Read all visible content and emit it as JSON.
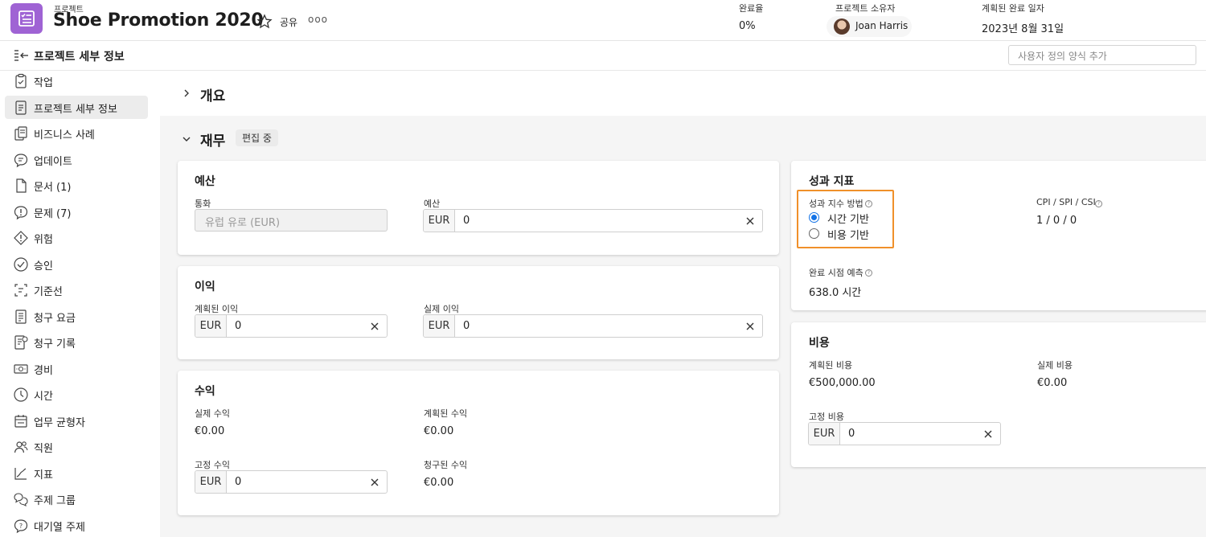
{
  "header": {
    "kicker": "프로젝트",
    "title": "Shoe Promotion 2020",
    "share_label": "공유",
    "more_label": "ooo",
    "completion_label": "완료율",
    "completion_value": "0%",
    "owner_label": "프로젝트 소유자",
    "owner_name": "Joan Harris",
    "planned_date_label": "계획된 완료 일자",
    "planned_date_value": "2023년 8월 31일"
  },
  "subheader": {
    "title": "프로젝트 세부 정보",
    "custom_form_placeholder": "사용자 정의 양식 추가"
  },
  "sidebar": {
    "items": [
      {
        "label": "작업",
        "icon": "task-clipboard-icon"
      },
      {
        "label": "프로젝트 세부 정보",
        "icon": "document-icon",
        "active": true
      },
      {
        "label": "비즈니스 사례",
        "icon": "business-case-icon"
      },
      {
        "label": "업데이트",
        "icon": "chat-bubble-icon"
      },
      {
        "label": "문서 (1)",
        "icon": "file-icon"
      },
      {
        "label": "문제 (7)",
        "icon": "issue-bubble-icon"
      },
      {
        "label": "위험",
        "icon": "risk-diamond-icon"
      },
      {
        "label": "승인",
        "icon": "approval-check-icon"
      },
      {
        "label": "기준선",
        "icon": "baseline-icon"
      },
      {
        "label": "청구 요금",
        "icon": "billing-rates-icon"
      },
      {
        "label": "청구 기록",
        "icon": "billing-records-icon"
      },
      {
        "label": "경비",
        "icon": "expense-money-icon"
      },
      {
        "label": "시간",
        "icon": "clock-icon"
      },
      {
        "label": "업무 균형자",
        "icon": "workload-calendar-icon"
      },
      {
        "label": "직원",
        "icon": "people-icon"
      },
      {
        "label": "지표",
        "icon": "metrics-line-icon"
      },
      {
        "label": "주제 그룹",
        "icon": "topic-group-icon"
      },
      {
        "label": "대기열 주제",
        "icon": "queue-topic-icon"
      }
    ]
  },
  "main": {
    "overview_title": "개요",
    "finance_title": "재무",
    "editing_badge": "편집 중",
    "budget": {
      "title": "예산",
      "currency_label": "통화",
      "currency_value": "유럽 유로 (EUR)",
      "budget_label": "예산",
      "budget_currency": "EUR",
      "budget_amount": "0"
    },
    "profit": {
      "title": "이익",
      "planned_label": "계획된 이익",
      "planned_currency": "EUR",
      "planned_amount": "0",
      "actual_label": "실제 이익",
      "actual_currency": "EUR",
      "actual_amount": "0"
    },
    "revenue": {
      "title": "수익",
      "actual_label": "실제 수익",
      "actual_value": "€0.00",
      "planned_label": "계획된 수익",
      "planned_value": "€0.00",
      "fixed_label": "고정 수익",
      "fixed_currency": "EUR",
      "fixed_amount": "0",
      "billed_label": "청구된 수익",
      "billed_value": "€0.00"
    },
    "performance": {
      "title": "성과 지표",
      "method_label": "성과 지수 방법",
      "option_time": "시간 기반",
      "option_cost": "비용 기반",
      "selected": "time",
      "cpi_label": "CPI / SPI / CSI",
      "cpi_value": "1 / 0 / 0",
      "forecast_label": "완료 시점 예측",
      "forecast_value": "638.0 시간"
    },
    "cost": {
      "title": "비용",
      "planned_label": "계획된 비용",
      "planned_value": "€500,000.00",
      "actual_label": "실제 비용",
      "actual_value": "€0.00",
      "fixed_label": "고정 비용",
      "fixed_currency": "EUR",
      "fixed_amount": "0"
    }
  },
  "colors": {
    "app_icon": "#9f63d4",
    "highlight": "#f0902a",
    "radio_active": "#1473e6"
  }
}
